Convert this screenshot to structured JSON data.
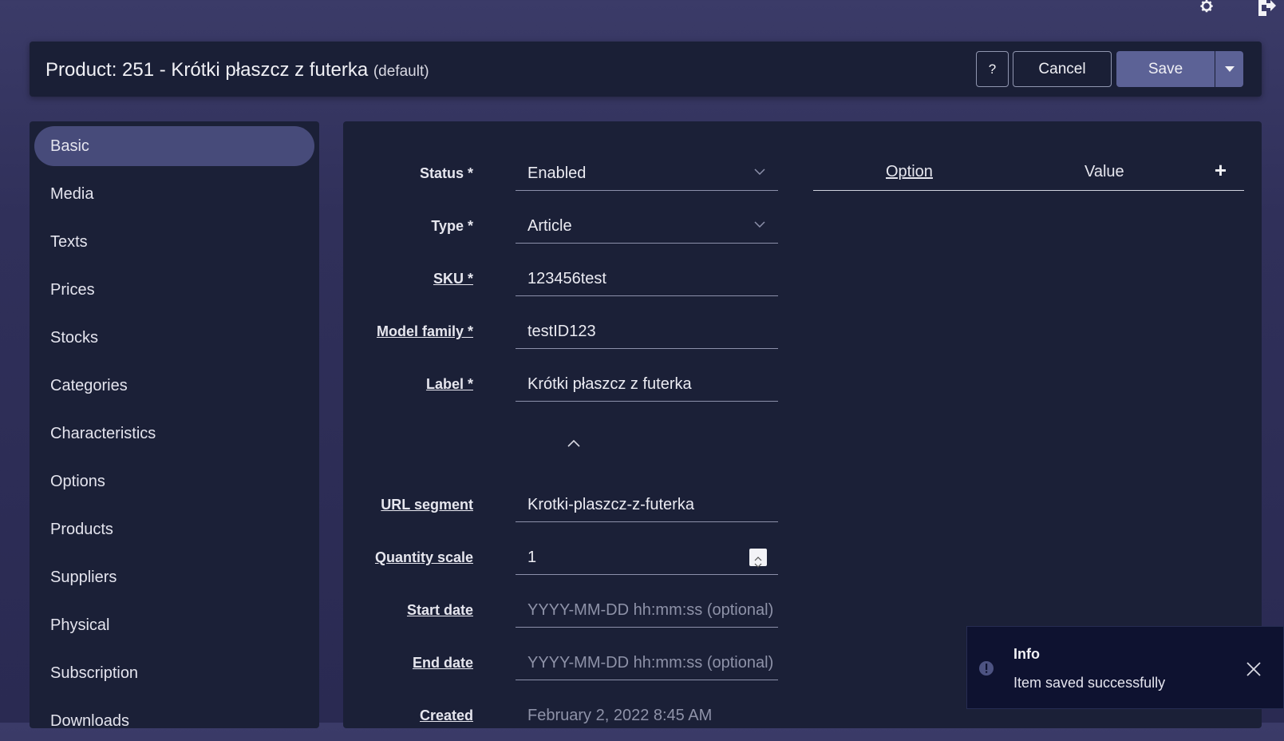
{
  "header": {
    "title": "Product: 251 - Krótki płaszcz z futerka",
    "subtitle": "(default)",
    "help_label": "?",
    "cancel_label": "Cancel",
    "save_label": "Save"
  },
  "top_icons": [
    "gear-icon",
    "logout-icon"
  ],
  "sidebar": {
    "items": [
      {
        "label": "Basic",
        "active": true
      },
      {
        "label": "Media"
      },
      {
        "label": "Texts"
      },
      {
        "label": "Prices"
      },
      {
        "label": "Stocks"
      },
      {
        "label": "Categories"
      },
      {
        "label": "Characteristics"
      },
      {
        "label": "Options"
      },
      {
        "label": "Products"
      },
      {
        "label": "Suppliers"
      },
      {
        "label": "Physical"
      },
      {
        "label": "Subscription"
      },
      {
        "label": "Downloads"
      }
    ]
  },
  "form": {
    "status": {
      "label": "Status *",
      "value": "Enabled"
    },
    "type": {
      "label": "Type *",
      "value": "Article"
    },
    "sku": {
      "label": "SKU *",
      "value": "123456test"
    },
    "model_family": {
      "label": "Model family *",
      "value": "testID123"
    },
    "label": {
      "label": "Label *",
      "value": "Krótki płaszcz z futerka"
    },
    "url_segment": {
      "label": "URL segment",
      "value": "Krotki-plaszcz-z-futerka"
    },
    "quantity_scale": {
      "label": "Quantity scale",
      "value": "1"
    },
    "start_date": {
      "label": "Start date",
      "placeholder": "YYYY-MM-DD hh:mm:ss (optional)"
    },
    "end_date": {
      "label": "End date",
      "placeholder": "YYYY-MM-DD hh:mm:ss (optional)"
    },
    "created": {
      "label": "Created",
      "value": "February 2, 2022 8:45 AM"
    }
  },
  "options_table": {
    "col_option": "Option",
    "col_value": "Value",
    "add_label": "+"
  },
  "toast": {
    "title": "Info",
    "message": "Item saved successfully"
  },
  "colors": {
    "background": "#33335e",
    "panel": "#1b2037",
    "accent": "#5c6296",
    "active_item": "#474b7a"
  }
}
